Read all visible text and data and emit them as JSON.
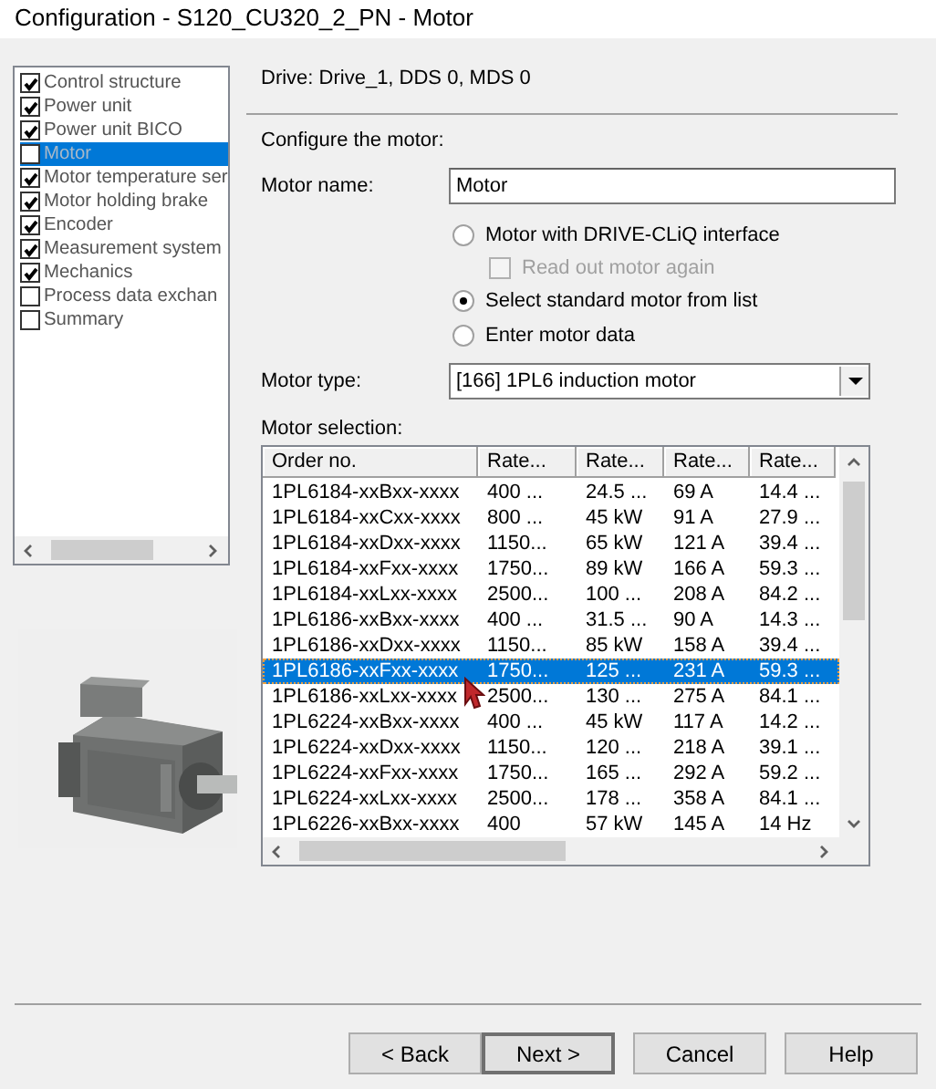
{
  "window": {
    "title": "Configuration - S120_CU320_2_PN - Motor"
  },
  "navigation": [
    {
      "label": "Control structure",
      "checked": true,
      "selected": false
    },
    {
      "label": "Power unit",
      "checked": true,
      "selected": false
    },
    {
      "label": "Power unit BICO",
      "checked": true,
      "selected": false
    },
    {
      "label": "Motor",
      "checked": false,
      "selected": true
    },
    {
      "label": "Motor temperature ser",
      "checked": true,
      "selected": false
    },
    {
      "label": "Motor holding brake",
      "checked": true,
      "selected": false
    },
    {
      "label": "Encoder",
      "checked": true,
      "selected": false
    },
    {
      "label": "Measurement system",
      "checked": true,
      "selected": false
    },
    {
      "label": "Mechanics",
      "checked": true,
      "selected": false
    },
    {
      "label": "Process data exchan",
      "checked": false,
      "selected": false
    },
    {
      "label": "Summary",
      "checked": false,
      "selected": false
    }
  ],
  "drive_info": "Drive: Drive_1, DDS 0, MDS 0",
  "section_label": "Configure the motor:",
  "motor_name": {
    "label": "Motor name:",
    "value": "Motor"
  },
  "motor_source": [
    {
      "kind": "radio",
      "label": "Motor with DRIVE-CLiQ interface",
      "selected": false
    },
    {
      "kind": "checkbox",
      "label": "Read out motor again",
      "checked": false,
      "disabled": true
    },
    {
      "kind": "radio",
      "label": "Select standard motor from list",
      "selected": true
    },
    {
      "kind": "radio",
      "label": "Enter motor data",
      "selected": false
    }
  ],
  "motor_type": {
    "label": "Motor type:",
    "value": "[166] 1PL6 induction motor"
  },
  "motor_selection": {
    "label": "Motor selection:",
    "columns": [
      "Order no.",
      "Rate...",
      "Rate...",
      "Rate...",
      "Rate..."
    ],
    "rows": [
      {
        "cells": [
          "1PL6184-xxBxx-xxxx",
          "400 ...",
          "24.5 ...",
          "69 A",
          "14.4 ..."
        ],
        "selected": false
      },
      {
        "cells": [
          "1PL6184-xxCxx-xxxx",
          "800 ...",
          "45 kW",
          "91 A",
          "27.9 ..."
        ],
        "selected": false
      },
      {
        "cells": [
          "1PL6184-xxDxx-xxxx",
          "1150...",
          "65 kW",
          "121 A",
          "39.4 ..."
        ],
        "selected": false
      },
      {
        "cells": [
          "1PL6184-xxFxx-xxxx",
          "1750...",
          "89 kW",
          "166 A",
          "59.3 ..."
        ],
        "selected": false
      },
      {
        "cells": [
          "1PL6184-xxLxx-xxxx",
          "2500...",
          "100 ...",
          "208 A",
          "84.2 ..."
        ],
        "selected": false
      },
      {
        "cells": [
          "1PL6186-xxBxx-xxxx",
          "400 ...",
          "31.5 ...",
          "90 A",
          "14.3 ..."
        ],
        "selected": false
      },
      {
        "cells": [
          "1PL6186-xxDxx-xxxx",
          "1150...",
          "85 kW",
          "158 A",
          "39.4 ..."
        ],
        "selected": false
      },
      {
        "cells": [
          "1PL6186-xxFxx-xxxx",
          "1750...",
          "125 ...",
          "231 A",
          "59.3 ..."
        ],
        "selected": true
      },
      {
        "cells": [
          "1PL6186-xxLxx-xxxx",
          "2500...",
          "130 ...",
          "275 A",
          "84.1 ..."
        ],
        "selected": false
      },
      {
        "cells": [
          "1PL6224-xxBxx-xxxx",
          "400 ...",
          "45 kW",
          "117 A",
          "14.2 ..."
        ],
        "selected": false
      },
      {
        "cells": [
          "1PL6224-xxDxx-xxxx",
          "1150...",
          "120 ...",
          "218 A",
          "39.1 ..."
        ],
        "selected": false
      },
      {
        "cells": [
          "1PL6224-xxFxx-xxxx",
          "1750...",
          "165 ...",
          "292 A",
          "59.2 ..."
        ],
        "selected": false
      },
      {
        "cells": [
          "1PL6224-xxLxx-xxxx",
          "2500...",
          "178 ...",
          "358 A",
          "84.1 ..."
        ],
        "selected": false
      },
      {
        "cells": [
          "1PL6226-xxBxx-xxxx",
          "400",
          "57 kW",
          "145 A",
          "14 Hz"
        ],
        "selected": false
      }
    ]
  },
  "buttons": [
    {
      "label": "< Back",
      "default": false
    },
    {
      "label": "Next >",
      "default": true
    },
    {
      "label": "Cancel",
      "default": false
    },
    {
      "label": "Help",
      "default": false
    }
  ]
}
